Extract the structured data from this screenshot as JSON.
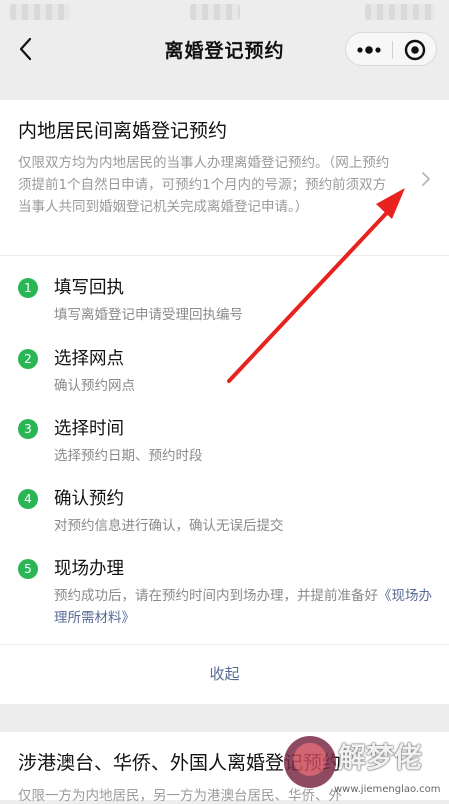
{
  "nav": {
    "title": "离婚登记预约"
  },
  "card": {
    "title": "内地居民间离婚登记预约",
    "description": "仅限双方均为内地居民的当事人办理离婚登记预约。（网上预约须提前1个自然日申请，可预约1个月内的号源；预约前须双方当事人共同到婚姻登记机关完成离婚登记申请。）",
    "steps": [
      {
        "num": "1",
        "title": "填写回执",
        "desc": "填写离婚登记申请受理回执编号"
      },
      {
        "num": "2",
        "title": "选择网点",
        "desc": "确认预约网点"
      },
      {
        "num": "3",
        "title": "选择时间",
        "desc": "选择预约日期、预约时段"
      },
      {
        "num": "4",
        "title": "确认预约",
        "desc": "对预约信息进行确认，确认无误后提交"
      },
      {
        "num": "5",
        "title": "现场办理",
        "desc": "预约成功后，请在预约时间内到场办理，并提前准备好",
        "link": "《现场办理所需材料》"
      }
    ],
    "collapse_label": "收起"
  },
  "card2": {
    "title": "涉港澳台、华侨、外国人离婚登记预约",
    "description": "仅限一方为内地居民，另一方为港澳台居民、华侨、外"
  },
  "watermark": {
    "text": "解梦佬",
    "url": "www.jiemenglao.com"
  },
  "colors": {
    "accent_green": "#2bb656",
    "link_blue": "#576b95",
    "arrow_red": "#e8231f"
  }
}
